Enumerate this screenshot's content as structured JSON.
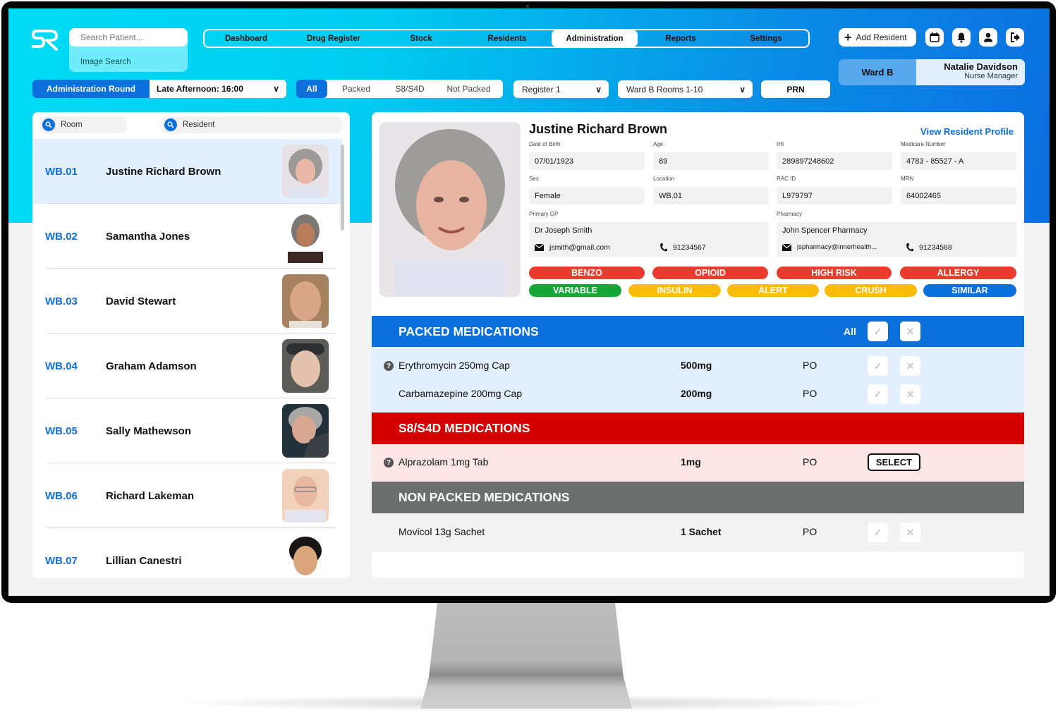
{
  "search": {
    "placeholder": "Search Patient...",
    "image_search": "Image Search"
  },
  "nav": {
    "items": [
      "Dashboard",
      "Drug Register",
      "Stock",
      "Residents",
      "Administration",
      "Reports",
      "Settings"
    ],
    "active": "Administration"
  },
  "header": {
    "add_resident": "Add Resident",
    "icons": [
      "calendar-icon",
      "bell-icon",
      "user-icon",
      "logout-icon"
    ],
    "ward": "Ward B",
    "user_name": "Natalie Davidson",
    "user_role": "Nurse Manager"
  },
  "filters": {
    "round_label": "Administration Round",
    "round_value": "Late Afternoon: 16:00",
    "segments": [
      "All",
      "Packed",
      "S8/S4D",
      "Not Packed"
    ],
    "active_segment": "All",
    "register": "Register 1",
    "ward_rooms": "Ward B Rooms 1-10",
    "prn": "PRN"
  },
  "left_panel": {
    "room_search": "Room",
    "resident_search": "Resident",
    "residents": [
      {
        "room": "WB.01",
        "name": "Justine Richard Brown",
        "active": true
      },
      {
        "room": "WB.02",
        "name": "Samantha Jones"
      },
      {
        "room": "WB.03",
        "name": "David Stewart"
      },
      {
        "room": "WB.04",
        "name": "Graham Adamson"
      },
      {
        "room": "WB.05",
        "name": "Sally Mathewson"
      },
      {
        "room": "WB.06",
        "name": "Richard Lakeman"
      },
      {
        "room": "WB.07",
        "name": "Lillian Canestri"
      }
    ]
  },
  "profile": {
    "name": "Justine Richard Brown",
    "view_profile": "View Resident Profile",
    "fields": {
      "dob": {
        "label": "Date of Birth",
        "value": "07/01/1923"
      },
      "age": {
        "label": "Age",
        "value": "89"
      },
      "ihi": {
        "label": "IHI",
        "value": "289897248602"
      },
      "medicare": {
        "label": "Medicare Number",
        "value": "4783 - 85527 - A"
      },
      "sex": {
        "label": "Sex",
        "value": "Female"
      },
      "location": {
        "label": "Location",
        "value": "WB.01"
      },
      "rac_id": {
        "label": "RAC ID",
        "value": "L979797"
      },
      "mrn": {
        "label": "MRN",
        "value": "64002465"
      }
    },
    "gp": {
      "label": "Primary GP",
      "name": "Dr Joseph Smith",
      "email": "jsmith@gmail.com",
      "phone": "91234567"
    },
    "pharmacy": {
      "label": "Pharmacy",
      "name": "John Spencer Pharmacy",
      "email": "jspharmacy@innerhealth...",
      "phone": "91234568"
    },
    "tags_row1": [
      {
        "label": "BENZO",
        "color": "#ea3b2e"
      },
      {
        "label": "OPIOID",
        "color": "#ea3b2e"
      },
      {
        "label": "HIGH RISK",
        "color": "#ea3b2e"
      },
      {
        "label": "ALLERGY",
        "color": "#ea3b2e"
      }
    ],
    "tags_row2": [
      {
        "label": "VARIABLE",
        "color": "#16a637"
      },
      {
        "label": "INSULIN",
        "color": "#fbbc0c"
      },
      {
        "label": "ALERT",
        "color": "#fbbc0c"
      },
      {
        "label": "CRUSH",
        "color": "#fbbc0c"
      },
      {
        "label": "SIMILAR",
        "color": "#0b6fdc"
      }
    ]
  },
  "medications": {
    "packed": {
      "title": "PACKED MEDICATIONS",
      "all_label": "All",
      "color": "#0b6fdc",
      "rows": [
        {
          "name": "Erythromycin 250mg Cap",
          "dose": "500mg",
          "route": "PO",
          "info": true
        },
        {
          "name": "Carbamazepine 200mg Cap",
          "dose": "200mg",
          "route": "PO",
          "info": false
        }
      ]
    },
    "s8": {
      "title": "S8/S4D MEDICATIONS",
      "color": "#d40000",
      "rows": [
        {
          "name": "Alprazolam 1mg Tab",
          "dose": "1mg",
          "route": "PO",
          "info": true,
          "action": "SELECT"
        }
      ]
    },
    "non_packed": {
      "title": "NON PACKED MEDICATIONS",
      "color": "#6d6f6e",
      "rows": [
        {
          "name": "Movicol 13g Sachet",
          "dose": "1 Sachet",
          "route": "PO",
          "info": false
        }
      ]
    }
  },
  "glyphs": {
    "check": "✓",
    "cross": "✕",
    "chevron": "∨",
    "plus": "+",
    "question": "?"
  }
}
